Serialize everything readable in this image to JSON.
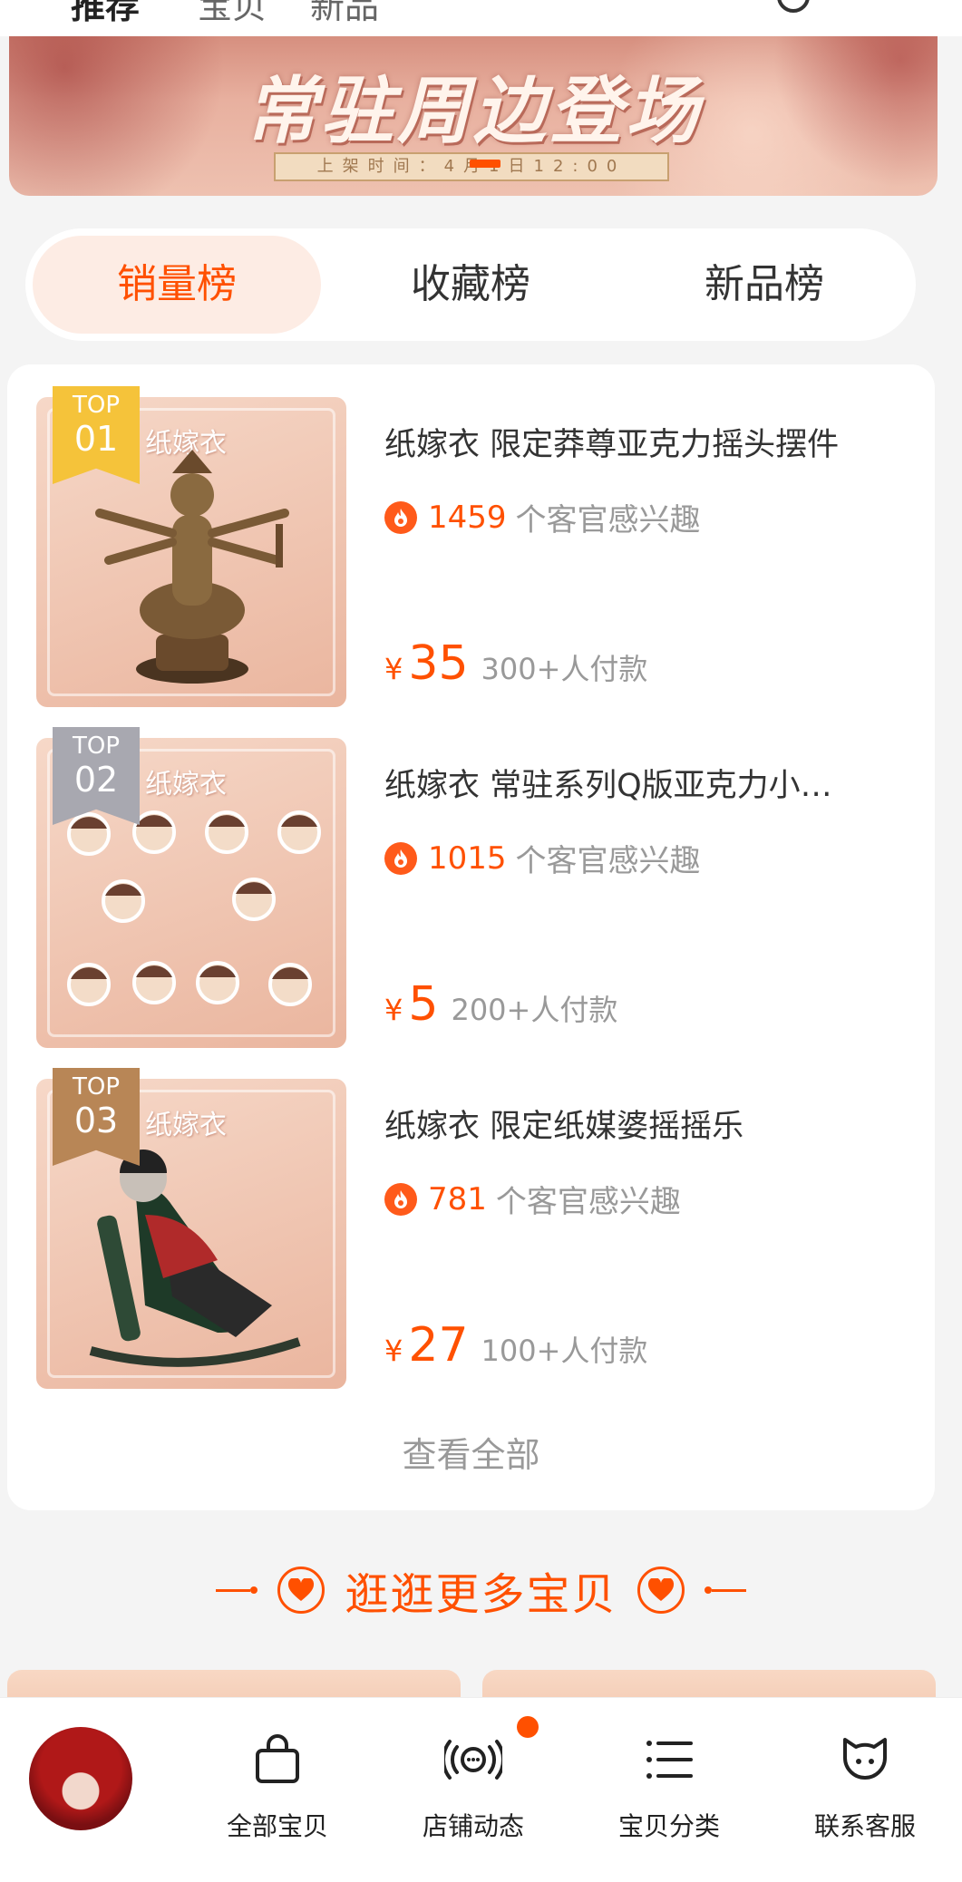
{
  "header": {
    "tabs": [
      "推荐",
      "宝贝",
      "新品"
    ]
  },
  "banner": {
    "title": "常驻周边登场",
    "time_text": "上架时间：4月1日12:00"
  },
  "rank_tabs": [
    {
      "label": "销量榜",
      "active": true
    },
    {
      "label": "收藏榜",
      "active": false
    },
    {
      "label": "新品榜",
      "active": false
    }
  ],
  "items": [
    {
      "badge_top": "TOP",
      "badge_num": "01",
      "title": "纸嫁衣 限定莽尊亚克力摇头摆件",
      "interest_count": "1459",
      "interest_suffix": "个客官感兴趣",
      "currency": "¥",
      "price": "35",
      "sales": "300+人付款",
      "watermark": "纸嫁衣",
      "badge_color": "#f5c33a"
    },
    {
      "badge_top": "TOP",
      "badge_num": "02",
      "title": "纸嫁衣 常驻系列Q版亚克力小…",
      "interest_count": "1015",
      "interest_suffix": "个客官感兴趣",
      "currency": "¥",
      "price": "5",
      "sales": "200+人付款",
      "watermark": "纸嫁衣",
      "badge_color": "#a8a8b0"
    },
    {
      "badge_top": "TOP",
      "badge_num": "03",
      "title": "纸嫁衣 限定纸媒婆摇摇乐",
      "interest_count": "781",
      "interest_suffix": "个客官感兴趣",
      "currency": "¥",
      "price": "27",
      "sales": "100+人付款",
      "watermark": "纸嫁衣",
      "badge_color": "#b88656"
    }
  ],
  "view_all": "查看全部",
  "more_section": {
    "title": "逛逛更多宝贝"
  },
  "bottom_nav": [
    {
      "label": "全部宝贝",
      "icon": "shopping-bag-icon"
    },
    {
      "label": "店铺动态",
      "icon": "broadcast-icon"
    },
    {
      "label": "宝贝分类",
      "icon": "list-icon"
    },
    {
      "label": "联系客服",
      "icon": "customer-service-icon"
    }
  ],
  "colors": {
    "accent": "#ff5000",
    "active_tab_bg": "#fdece4"
  }
}
